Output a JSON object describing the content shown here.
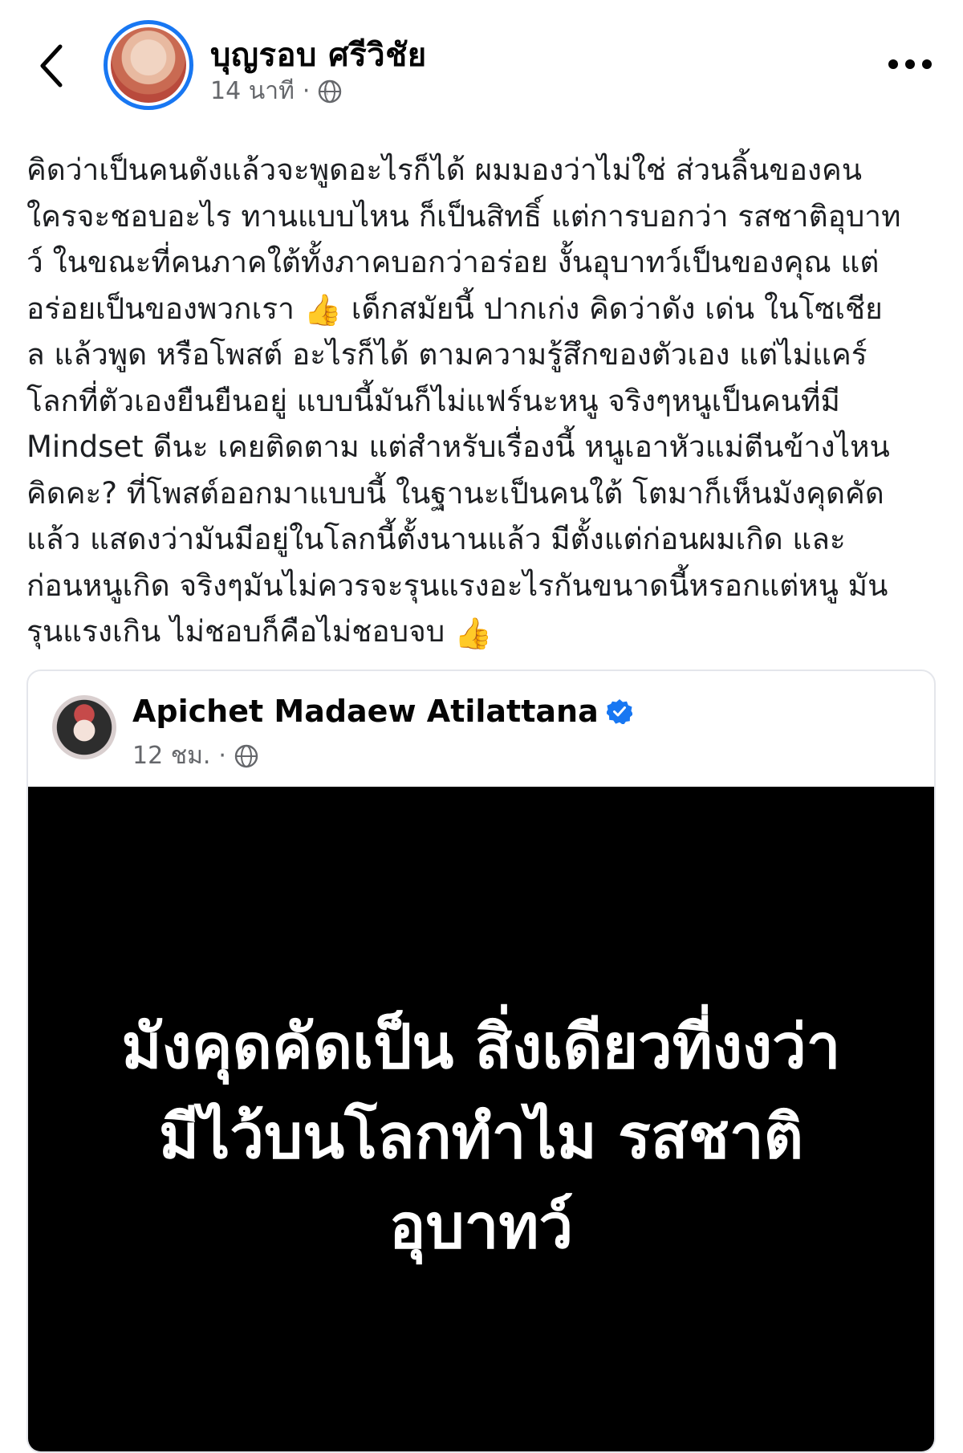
{
  "header": {
    "author_name": "บุญรอบ ศรีวิชัย",
    "time": "14 นาที",
    "separator": "·",
    "icons": {
      "back": "back-chevron-icon",
      "audience": "globe-icon",
      "more": "more-options-icon"
    }
  },
  "post": {
    "lines": [
      "คิดว่าเป็นคนดังแล้วจะพูดอะไรก็ได้  ผมมองว่าไม่ใช่ ส่วนลิ้นของคน",
      "ใครจะชอบอะไร ทานแบบไหน ก็เป็นสิทธิ์ แต่การบอกว่า รสชาติอุบาท",
      "ว์  ในขณะที่คนภาคใต้ทั้งภาคบอกว่าอร่อย งั้นอุบาทว์เป็นของคุณ แต่",
      "อร่อยเป็นของพวกเรา",
      " เด็กสมัยนี้ ปากเก่ง คิดว่าดัง เด่น ในโซเชีย",
      "ล แล้วพูด หรือโพสต์ อะไรก็ได้ ตามความรู้สึกของตัวเอง แต่ไม่แคร์",
      "โลกที่ตัวเองยืนยืนอยู่ แบบนี้มันก็ไม่แฟร์นะหนู    จริงๆหนูเป็นคนที่มี",
      "Mindset ดีนะ เคยติดตาม แต่สำหรับเรื่องนี้ หนูเอาหัวแม่ตีนข้างไหน",
      "คิดคะ? ที่โพสต์ออกมาแบบนี้ ในฐานะเป็นคนใต้ โตมาก็เห็นมังคุดคัด",
      "แล้ว แสดงว่ามันมีอยู่ในโลกนี้ตั้งนานแล้ว มีตั้งแต่ก่อนผมเกิด และ",
      "ก่อนหนูเกิด จริงๆมันไม่ควรจะรุนแรงอะไรกันขนาดนี้หรอกแต่หนู มัน",
      "รุนแรงเกิน ไม่ชอบก็คือไม่ชอบจบ"
    ],
    "emoji_thumbs_up": "👍"
  },
  "shared_post": {
    "author_name": "Apichet Madaew Atilattana",
    "verified_icon": "verified-badge-icon",
    "time": "12 ชม.",
    "separator": "·",
    "image_text_lines": [
      "มังคุดคัดเป็น สิ่งเดียวที่งงว่า",
      "มีไว้บนโลกทำไม รสชาติ",
      "อุบาทว์"
    ]
  },
  "colors": {
    "accent": "#1877f2",
    "secondary_text": "#65676b",
    "image_background": "#000000"
  }
}
